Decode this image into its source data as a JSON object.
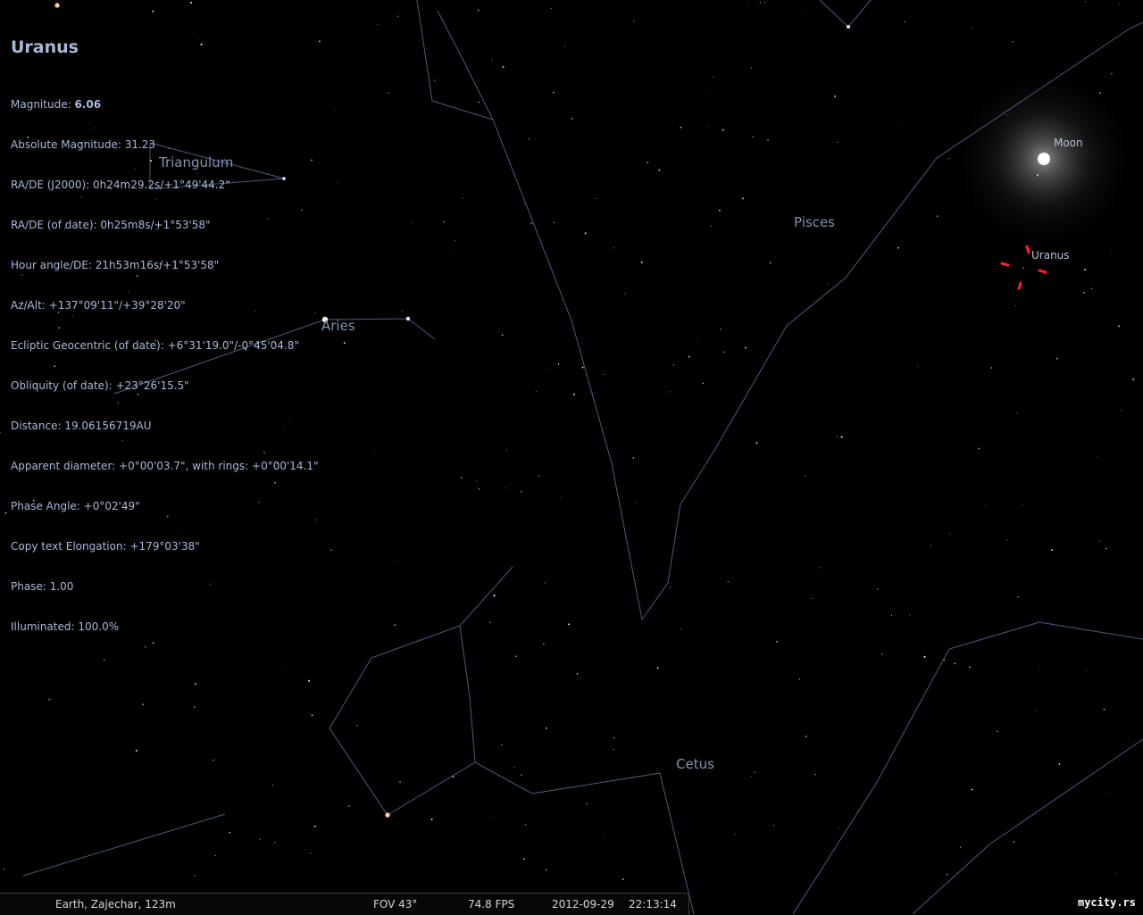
{
  "object": {
    "name": "Uranus",
    "magnitude_label": "Magnitude: ",
    "magnitude_value": "6.06",
    "lines": [
      "Absolute Magnitude: 31.23",
      "RA/DE (J2000): 0h24m29.2s/+1°49'44.2\"",
      "RA/DE (of date): 0h25m8s/+1°53'58\"",
      "Hour angle/DE: 21h53m16s/+1°53'58\"",
      "Az/Alt: +137°09'11\"/+39°28'20\"",
      "Ecliptic Geocentric (of date): +6°31'19.0\"/-0°45'04.8\"",
      "Obliquity (of date): +23°26'15.5\"",
      "Distance: 19.06156719AU",
      "Apparent diameter: +0°00'03.7\", with rings: +0°00'14.1\"",
      "Phase Angle: +0°02'49\"",
      "Copy text Elongation: +179°03'38\"",
      "Phase: 1.00",
      "Illuminated: 100.0%"
    ]
  },
  "constellations": {
    "triangulum": "Triangulum",
    "aries": "Aries",
    "pisces": "Pisces",
    "cetus": "Cetus"
  },
  "labels": {
    "moon": "Moon",
    "uranus": "Uranus"
  },
  "status_bar": {
    "location": "Earth, Zajechar, 123m",
    "fov": "FOV 43°",
    "fps": "74.8 FPS",
    "date": "2012-09-29",
    "time": "22:13:14"
  },
  "watermark": "mycity.rs",
  "colors": {
    "info_text": "#a9b8d8",
    "constellation_line": "#4a5a80",
    "selection_marker": "#ff2020"
  }
}
